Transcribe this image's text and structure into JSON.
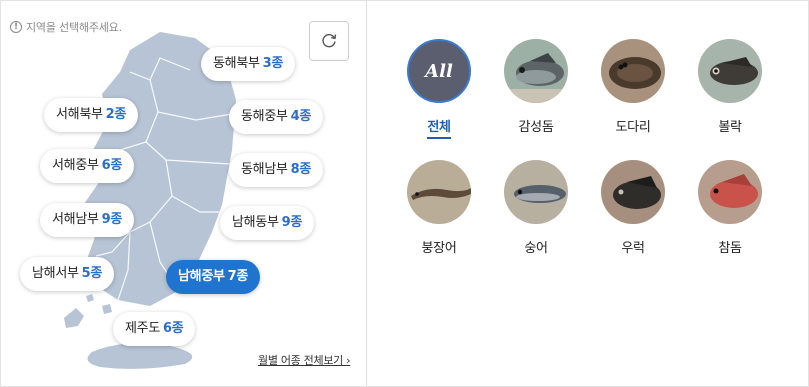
{
  "notice": {
    "icon": "info-icon",
    "text": "지역을 선택해주세요."
  },
  "refresh": {
    "icon": "refresh-icon"
  },
  "colors": {
    "accent": "#1f74cf",
    "count": "#2a6fc7",
    "map": "#b6c4d6",
    "selected_ring": "#3a7ad0"
  },
  "regions": [
    {
      "name": "동해북부",
      "count": "3종",
      "active": false
    },
    {
      "name": "서해북부",
      "count": "2종",
      "active": false
    },
    {
      "name": "동해중부",
      "count": "4종",
      "active": false
    },
    {
      "name": "서해중부",
      "count": "6종",
      "active": false
    },
    {
      "name": "동해남부",
      "count": "8종",
      "active": false
    },
    {
      "name": "서해남부",
      "count": "9종",
      "active": false
    },
    {
      "name": "남해동부",
      "count": "9종",
      "active": false
    },
    {
      "name": "남해서부",
      "count": "5종",
      "active": false
    },
    {
      "name": "남해중부",
      "count": "7종",
      "active": true
    },
    {
      "name": "제주도",
      "count": "6종",
      "active": false
    }
  ],
  "monthly_link": "월별 어종 전체보기",
  "fish": [
    {
      "name": "전체",
      "thumb_label": "All",
      "selected": true
    },
    {
      "name": "감성돔",
      "selected": false
    },
    {
      "name": "도다리",
      "selected": false
    },
    {
      "name": "볼락",
      "selected": false
    },
    {
      "name": "붕장어",
      "selected": false
    },
    {
      "name": "숭어",
      "selected": false
    },
    {
      "name": "우럭",
      "selected": false
    },
    {
      "name": "참돔",
      "selected": false
    }
  ]
}
